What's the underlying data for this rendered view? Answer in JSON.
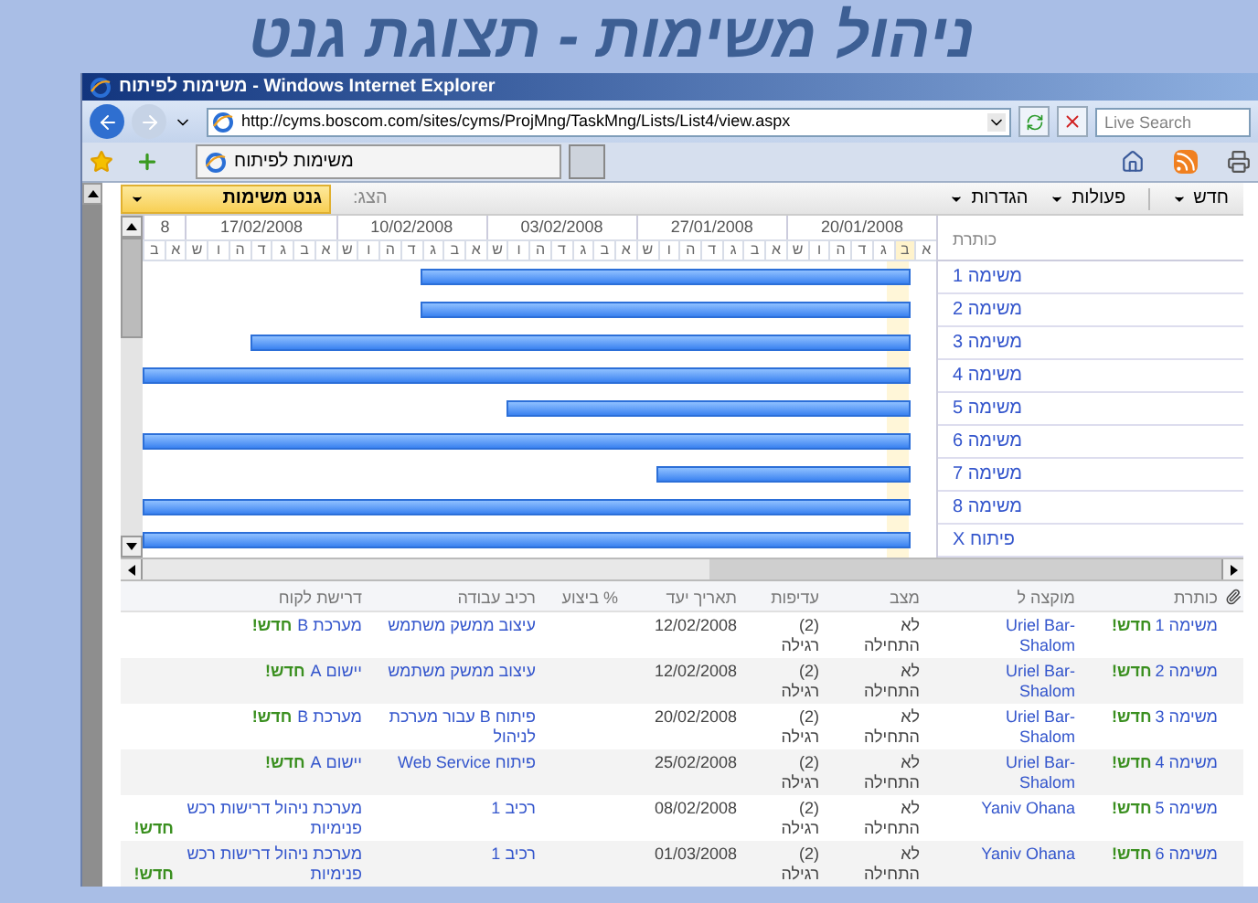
{
  "slide_title": "ניהול משימות - תצוגת גנט",
  "browser": {
    "title": "משימות לפיתוח - Windows Internet Explorer",
    "address": "http://cyms.boscom.com/sites/cyms/ProjMng/TaskMng/Lists/List4/view.aspx",
    "search_placeholder": "Live Search",
    "tab": "משימות לפיתוח"
  },
  "toolbar": {
    "menus": [
      "חדש",
      "פעולות",
      "הגדרות"
    ],
    "view_label": "הצג:",
    "view_value": "גנט משימות"
  },
  "gantt": {
    "title_header": "כותרת",
    "weeks": [
      "20/01/2008",
      "27/01/2008",
      "03/02/2008",
      "10/02/2008",
      "17/02/2008",
      "8"
    ],
    "days": [
      "א",
      "ב",
      "ג",
      "ד",
      "ה",
      "ו",
      "ש",
      "א",
      "ב",
      "ג",
      "ד",
      "ה",
      "ו",
      "ש",
      "א",
      "ב",
      "ג",
      "ד",
      "ה",
      "ו",
      "ש",
      "א",
      "ב",
      "ג",
      "ד",
      "ה",
      "ו",
      "ש",
      "א",
      "ב",
      "ג",
      "ד",
      "ה",
      "ו",
      "ש",
      "א",
      "ב"
    ],
    "rows": [
      "משימה 1",
      "משימה 2",
      "משימה 3",
      "משימה 4",
      "משימה 5",
      "משימה 6",
      "משימה 7",
      "משימה 8",
      "פיתוח X"
    ]
  },
  "list": {
    "columns": [
      "כותרת",
      "מוקצה ל",
      "מצב",
      "עדיפות",
      "תאריך יעד",
      "% ביצוע",
      "רכיב עבודה",
      "דרישת לקוח"
    ],
    "rows": [
      {
        "title": "משימה 1",
        "badge": "חדש!",
        "assigned": "Uriel Bar-Shalom",
        "status": "לא התחילה",
        "priority": "(2) רגילה",
        "due": "12/02/2008",
        "work_item": "עיצוב ממשק משתמש",
        "customer": "מערכת B",
        "customer_badge": "חדש!"
      },
      {
        "title": "משימה 2",
        "badge": "חדש!",
        "assigned": "Uriel Bar-Shalom",
        "status": "לא התחילה",
        "priority": "(2) רגילה",
        "due": "12/02/2008",
        "work_item": "עיצוב ממשק משתמש",
        "customer": "יישום A",
        "customer_badge": "חדש!"
      },
      {
        "title": "משימה 3",
        "badge": "חדש!",
        "assigned": "Uriel Bar-Shalom",
        "status": "לא התחילה",
        "priority": "(2) רגילה",
        "due": "20/02/2008",
        "work_item": "פיתוח B עבור מערכת לניהול",
        "customer": "מערכת B",
        "customer_badge": "חדש!"
      },
      {
        "title": "משימה 4",
        "badge": "חדש!",
        "assigned": "Uriel Bar-Shalom",
        "status": "לא התחילה",
        "priority": "(2) רגילה",
        "due": "25/02/2008",
        "work_item": "פיתוח Web Service",
        "customer": "יישום A",
        "customer_badge": "חדש!"
      },
      {
        "title": "משימה 5",
        "badge": "חדש!",
        "assigned": "Yaniv Ohana",
        "status": "לא התחילה",
        "priority": "(2) רגילה",
        "due": "08/02/2008",
        "work_item": "רכיב 1",
        "customer": "מערכת ניהול דרישות רכש פנימיות",
        "customer_badge": "חדש!"
      },
      {
        "title": "משימה 6",
        "badge": "חדש!",
        "assigned": "Yaniv Ohana",
        "status": "לא התחילה",
        "priority": "(2) רגילה",
        "due": "01/03/2008",
        "work_item": "רכיב 1",
        "customer": "מערכת ניהול דרישות רכש פנימיות",
        "customer_badge": "חדש!"
      }
    ]
  }
}
